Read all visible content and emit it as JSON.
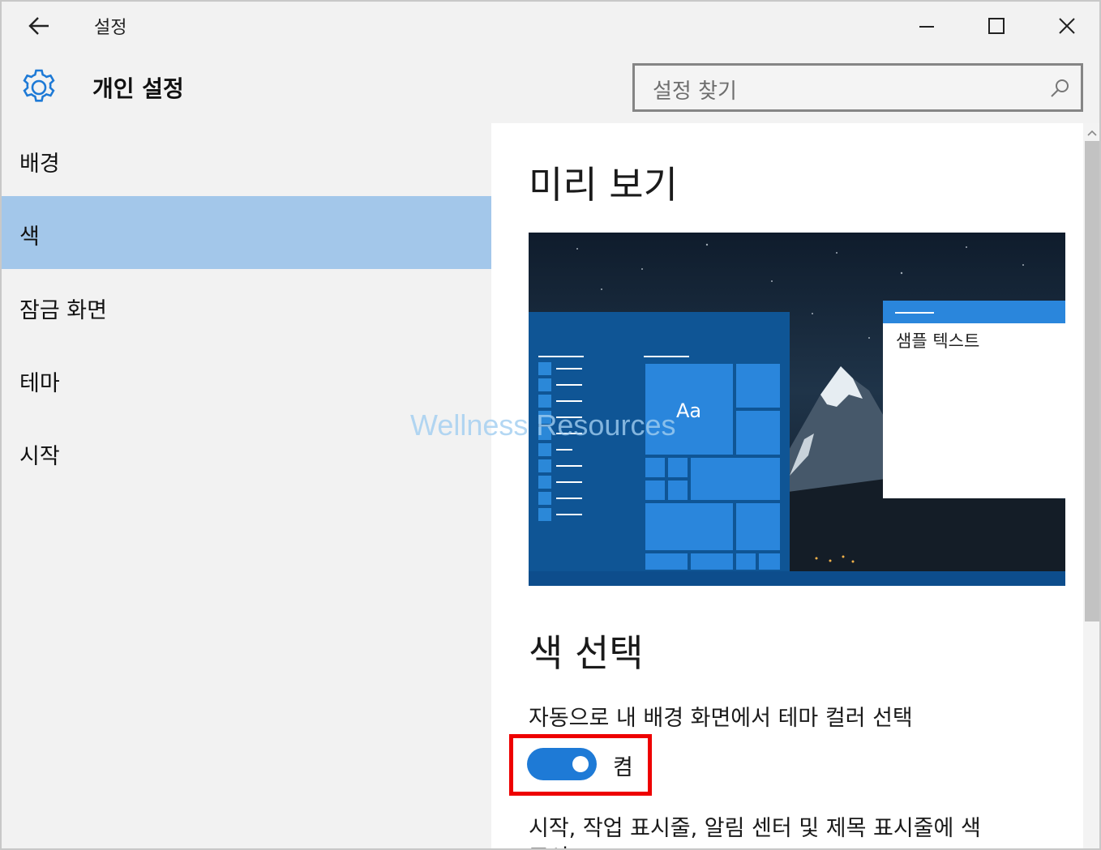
{
  "window": {
    "title": "설정"
  },
  "header": {
    "title": "개인 설정",
    "search_placeholder": "설정 찾기"
  },
  "sidebar": {
    "items": [
      {
        "label": "배경",
        "selected": false
      },
      {
        "label": "색",
        "selected": true
      },
      {
        "label": "잠금 화면",
        "selected": false
      },
      {
        "label": "테마",
        "selected": false
      },
      {
        "label": "시작",
        "selected": false
      }
    ]
  },
  "content": {
    "preview_title": "미리 보기",
    "preview": {
      "sample_text": "샘플 텍스트",
      "tile_label": "Aa"
    },
    "color_title": "색 선택",
    "auto_color_label": "자동으로 내 배경 화면에서 테마 컬러 선택",
    "toggle": {
      "state_label": "켬",
      "on": true
    },
    "next_setting_label": "시작, 작업 표시줄, 알림 센터 및 제목 표시줄에 색",
    "next_setting_label_2": "표시"
  },
  "watermark": "Wellness Resources",
  "colors": {
    "accent": "#1e7ad6",
    "selection": "#a3c7ea",
    "highlight_box": "#ee0000"
  }
}
